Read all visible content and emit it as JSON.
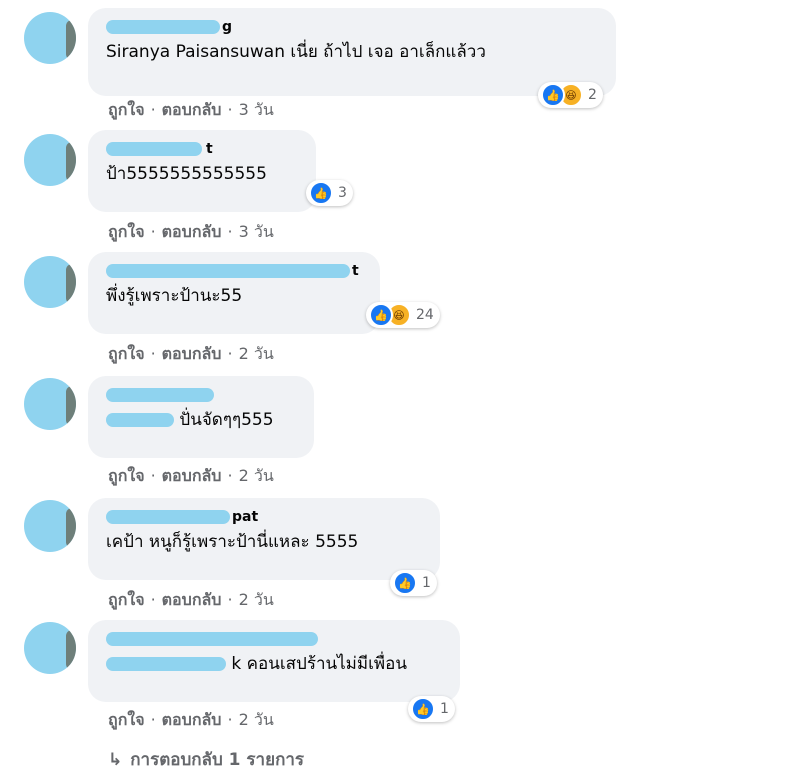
{
  "comments": [
    {
      "name_tail": "g",
      "text": "Siranya Paisansuwan เนี่ย ถ้าไป เจอ อาเล็กแล้วว",
      "reaction_types": [
        "like-icon",
        "haha-icon"
      ],
      "reaction_count": "2",
      "actions": {
        "like": "ถูกใจ",
        "reply": "ตอบกลับ",
        "time": "3 วัน"
      }
    },
    {
      "name_tail": "t",
      "text": "ป้า5555555555555",
      "reaction_types": [
        "like-icon"
      ],
      "reaction_count": "3",
      "actions": {
        "like": "ถูกใจ",
        "reply": "ตอบกลับ",
        "time": "3 วัน"
      }
    },
    {
      "name_tail": "t",
      "text": "พึ่งรู้เพราะป้านะ55",
      "reaction_types": [
        "like-icon",
        "haha-icon"
      ],
      "reaction_count": "24",
      "actions": {
        "like": "ถูกใจ",
        "reply": "ตอบกลับ",
        "time": "2 วัน"
      }
    },
    {
      "name_tail": "",
      "text": "ปั่นจัดๆๆ555",
      "reaction_types": [],
      "reaction_count": "",
      "actions": {
        "like": "ถูกใจ",
        "reply": "ตอบกลับ",
        "time": "2 วัน"
      }
    },
    {
      "name_tail": "pat",
      "text": "เคป้า หนูก็รู้เพราะป้านี่แหละ 5555",
      "reaction_types": [
        "like-icon"
      ],
      "reaction_count": "1",
      "actions": {
        "like": "ถูกใจ",
        "reply": "ตอบกลับ",
        "time": "2 วัน"
      }
    },
    {
      "name_tail": "",
      "text": "k คอนเสปร้านไม่มีเพื่อน",
      "reaction_types": [
        "like-icon"
      ],
      "reaction_count": "1",
      "actions": {
        "like": "ถูกใจ",
        "reply": "ตอบกลับ",
        "time": "2 วัน"
      }
    }
  ],
  "view_replies": {
    "arrow": "↳",
    "label": "การตอบกลับ 1 รายการ"
  },
  "colors": {
    "bubble": "#f0f2f5",
    "meta": "#65676b",
    "like": "#1877f2",
    "haha": "#f7b125",
    "redaction": "#8fd3ef"
  }
}
